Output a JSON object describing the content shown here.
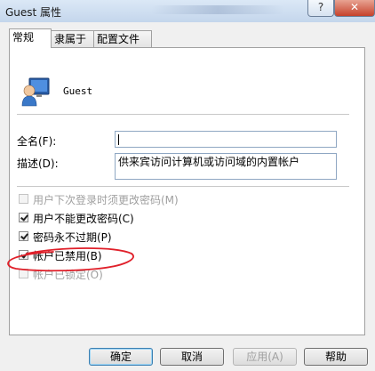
{
  "window": {
    "title": "Guest 属性",
    "help_label": "?",
    "close_label": "✕"
  },
  "tabs": [
    {
      "label": "常规",
      "active": true
    },
    {
      "label": "隶属于",
      "active": false
    },
    {
      "label": "配置文件",
      "active": false
    }
  ],
  "user": {
    "name": "Guest",
    "icon": "user-icon"
  },
  "fields": {
    "full_name_label": "全名(F):",
    "full_name_value": "",
    "description_label": "描述(D):",
    "description_value": "供来宾访问计算机或访问域的内置帐户"
  },
  "checkboxes": [
    {
      "label": "用户下次登录时须更改密码(M)",
      "checked": false,
      "disabled": true
    },
    {
      "label": "用户不能更改密码(C)",
      "checked": true,
      "disabled": false
    },
    {
      "label": "密码永不过期(P)",
      "checked": true,
      "disabled": false
    },
    {
      "label": "帐户已禁用(B)",
      "checked": true,
      "disabled": false
    },
    {
      "label": "帐户已锁定(O)",
      "checked": false,
      "disabled": true
    }
  ],
  "buttons": {
    "ok": "确定",
    "cancel": "取消",
    "apply": "应用(A)",
    "help": "帮助"
  },
  "colors": {
    "annotation": "#e0202a",
    "titlebar": "#c4d6ec",
    "close": "#c5422c"
  }
}
